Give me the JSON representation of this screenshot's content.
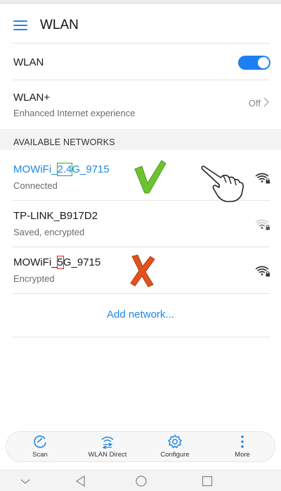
{
  "app": {
    "title": "WLAN"
  },
  "wlan": {
    "label": "WLAN",
    "enabled": true
  },
  "wlan_plus": {
    "label": "WLAN+",
    "subtitle": "Enhanced Internet experience",
    "value": "Off"
  },
  "section": {
    "available_networks": "AVAILABLE NETWORKS"
  },
  "networks": [
    {
      "name_pre": "MOWiFi_",
      "name_mark": "2.4",
      "name_post": "G_9715",
      "status": "Connected",
      "signal": "full-lock"
    },
    {
      "name": "TP-LINK_B917D2",
      "status": "Saved, encrypted",
      "signal": "low-lock"
    },
    {
      "name_pre": "MOWiFi_",
      "name_mark": "5",
      "name_post": "G_9715",
      "status": "Encrypted",
      "signal": "full-lock"
    }
  ],
  "add_network": {
    "label": "Add network..."
  },
  "toolbar": {
    "scan": "Scan",
    "wlan_direct": "WLAN Direct",
    "configure": "Configure",
    "more": "More"
  },
  "colors": {
    "accent": "#1e88e5",
    "toggle": "#1e7ff2",
    "check": "#6dc32e",
    "cross": "#e0531e"
  }
}
